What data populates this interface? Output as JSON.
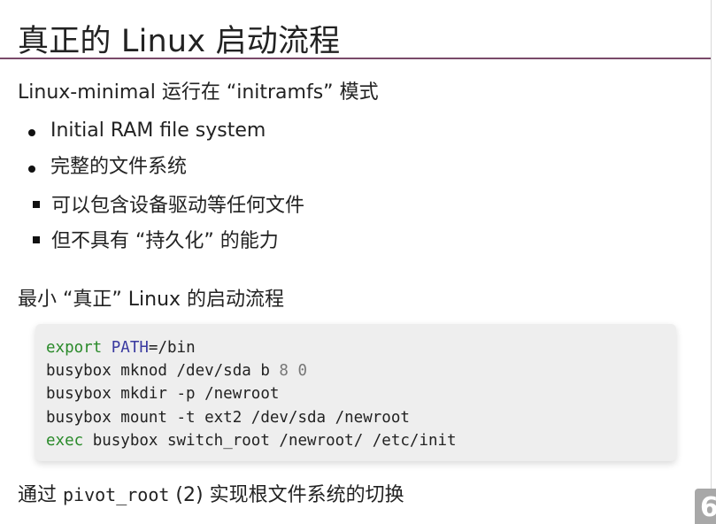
{
  "slide": {
    "title": "真正的 Linux 启动流程",
    "intro": "Linux-minimal 运行在 “initramfs” 模式",
    "bullets": [
      {
        "text": "Initial RAM file system"
      },
      {
        "text": "完整的文件系统"
      }
    ],
    "sub_bullets": [
      {
        "text": "可以包含设备驱动等任何文件"
      },
      {
        "text": "但不具有 “持久化” 的能力"
      }
    ],
    "section_heading": "最小 “真正” Linux 的启动流程",
    "code": {
      "line1_kw": "export",
      "line1_var": "PATH",
      "line1_rest": "=/bin",
      "line2_a": "busybox mknod /dev/sda b ",
      "line2_n1": "8",
      "line2_sp": " ",
      "line2_n2": "0",
      "line3": "busybox mkdir -p /newroot",
      "line4": "busybox mount -t ext2 /dev/sda /newroot",
      "line5_kw": "exec",
      "line5_rest": " busybox switch_root /newroot/ /etc/init"
    },
    "footer": {
      "prefix": "通过 ",
      "code": "pivot_root",
      "suffix": " (2) 实现根文件系统的切换"
    },
    "page_number": "6"
  },
  "colors": {
    "rule": "#7a4a6a",
    "keyword": "#2a8a2a",
    "variable": "#3a3aa0",
    "number": "#777777",
    "code_bg": "#eeeeee"
  }
}
